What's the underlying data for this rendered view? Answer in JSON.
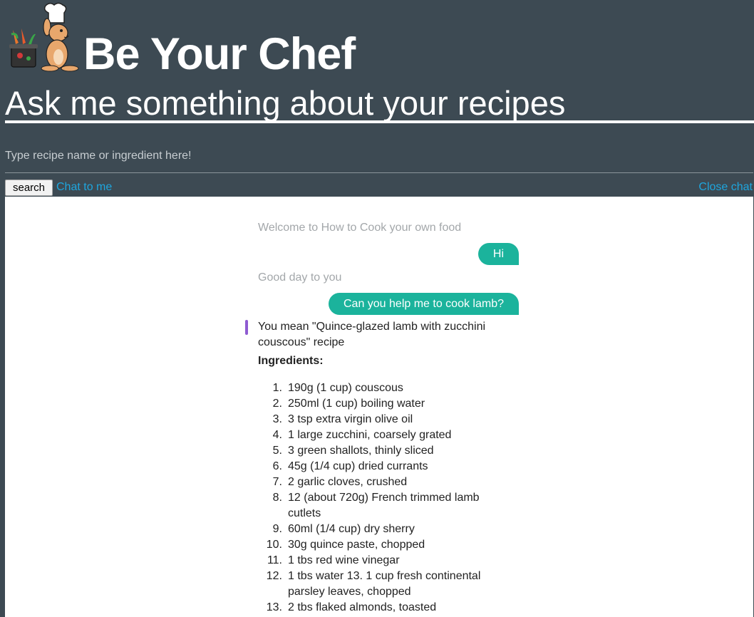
{
  "header": {
    "brand": "Be Your Chef",
    "subtitle": "Ask me something about your recipes",
    "logo_icon": "chef-rabbit-icon"
  },
  "search": {
    "placeholder": "Type recipe name or ingredient here!",
    "button_label": "search"
  },
  "links": {
    "chat": "Chat to me",
    "close": "Close chat"
  },
  "chat": {
    "welcome": "Welcome to How to Cook your own food",
    "user_1": "Hi",
    "bot_1": "Good day to you",
    "user_2": "Can you help me to cook lamb?",
    "bot_2": "You mean \"Quince-glazed lamb with zucchini couscous\" recipe",
    "ingredients_title": "Ingredients:",
    "ingredients": [
      {
        "num": "1.",
        "text": "190g (1 cup) couscous"
      },
      {
        "num": "2.",
        "text": "250ml (1 cup) boiling water"
      },
      {
        "num": "3.",
        "text": "3 tsp extra virgin olive oil"
      },
      {
        "num": "4.",
        "text": "1 large zucchini, coarsely grated"
      },
      {
        "num": "5.",
        "text": "3 green shallots, thinly sliced"
      },
      {
        "num": "6.",
        "text": "45g (1/4 cup) dried currants"
      },
      {
        "num": "7.",
        "text": "2 garlic cloves, crushed"
      },
      {
        "num": "8.",
        "text": "12 (about 720g) French trimmed lamb cutlets"
      },
      {
        "num": "9.",
        "text": "60ml (1/4 cup) dry sherry"
      },
      {
        "num": "10.",
        "text": "30g quince paste, chopped"
      },
      {
        "num": "11.",
        "text": "1 tbs red wine vinegar"
      },
      {
        "num": "12.",
        "text": "1 tbs water 13. 1 cup fresh continental parsley leaves, chopped"
      },
      {
        "num": "13.",
        "text": "2 tbs flaked almonds, toasted"
      }
    ]
  },
  "colors": {
    "background": "#3d4a53",
    "link": "#1ea6de",
    "user_bubble": "#1bb39c",
    "bot_marker": "#8e5bd1"
  }
}
